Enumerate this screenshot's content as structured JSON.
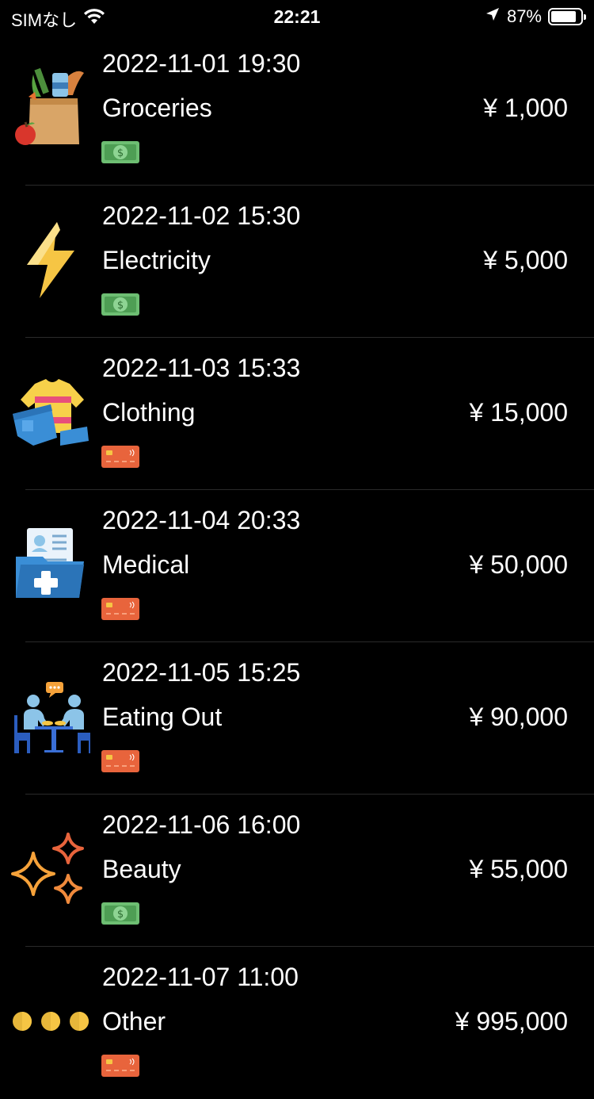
{
  "status_bar": {
    "carrier": "SIMなし",
    "time": "22:21",
    "battery": "87%",
    "battery_level": 0.87
  },
  "transactions": [
    {
      "datetime": "2022-11-01 19:30",
      "category": "Groceries",
      "amount": "¥ 1,000",
      "icon": "groceries-bag-icon",
      "payment": "cash"
    },
    {
      "datetime": "2022-11-02 15:30",
      "category": "Electricity",
      "amount": "¥ 5,000",
      "icon": "lightning-bolt-icon",
      "payment": "cash"
    },
    {
      "datetime": "2022-11-03 15:33",
      "category": "Clothing",
      "amount": "¥ 15,000",
      "icon": "clothing-icon",
      "payment": "card"
    },
    {
      "datetime": "2022-11-04 20:33",
      "category": "Medical",
      "amount": "¥ 50,000",
      "icon": "medical-folder-icon",
      "payment": "card"
    },
    {
      "datetime": "2022-11-05 15:25",
      "category": "Eating Out",
      "amount": "¥ 90,000",
      "icon": "dining-people-icon",
      "payment": "card"
    },
    {
      "datetime": "2022-11-06 16:00",
      "category": "Beauty",
      "amount": "¥ 55,000",
      "icon": "sparkles-icon",
      "payment": "cash"
    },
    {
      "datetime": "2022-11-07 11:00",
      "category": "Other",
      "amount": "¥ 995,000",
      "icon": "three-dots-icon",
      "payment": "card"
    }
  ],
  "colors": {
    "background": "#000000",
    "cash_green": "#6DBE72",
    "card_orange": "#E8643C"
  }
}
